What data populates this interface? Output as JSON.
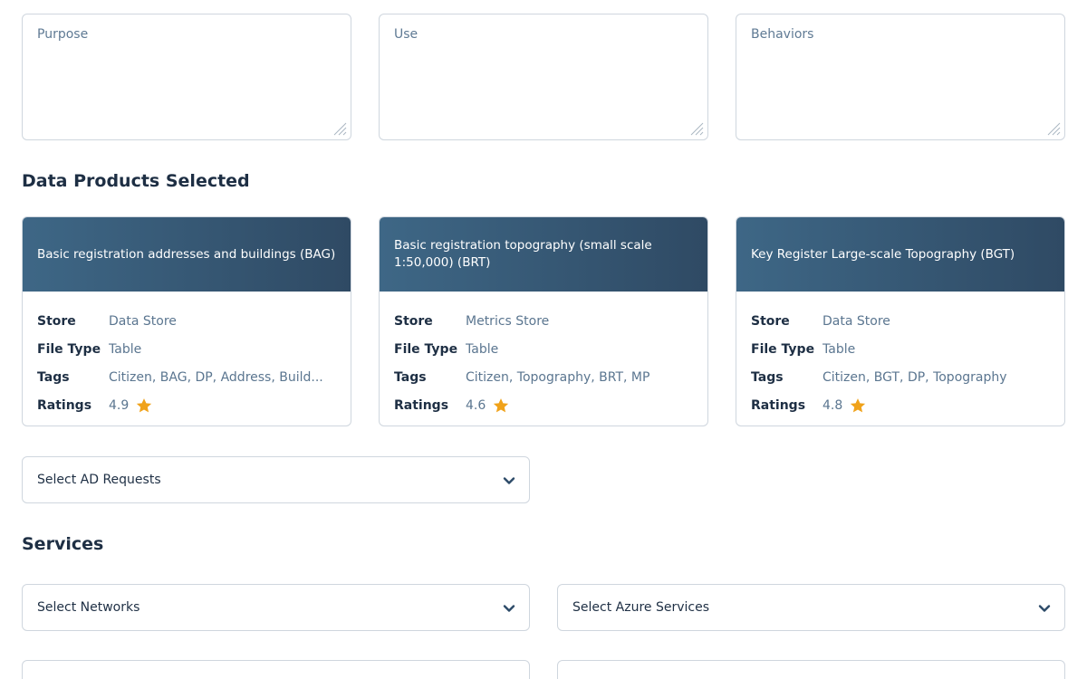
{
  "textareas": [
    {
      "placeholder": "Purpose"
    },
    {
      "placeholder": "Use"
    },
    {
      "placeholder": "Behaviors"
    }
  ],
  "data_products": {
    "title": "Data Products Selected",
    "labels": {
      "store": "Store",
      "file_type": "File Type",
      "tags": "Tags",
      "ratings": "Ratings"
    },
    "cards": [
      {
        "title": "Basic registration addresses and buildings (BAG)",
        "store": "Data Store",
        "file_type": "Table",
        "tags": "Citizen, BAG, DP, Address, Build...",
        "rating": "4.9"
      },
      {
        "title": "Basic registration topography (small scale 1:50,000) (BRT)",
        "store": "Metrics Store",
        "file_type": "Table",
        "tags": "Citizen, Topography, BRT, MP",
        "rating": "4.6"
      },
      {
        "title": "Key Register Large-scale Topography (BGT)",
        "store": "Data Store",
        "file_type": "Table",
        "tags": "Citizen, BGT, DP, Topography",
        "rating": "4.8"
      }
    ],
    "star_color": "#f0a21a"
  },
  "ad_requests": {
    "placeholder": "Select AD Requests"
  },
  "services": {
    "title": "Services",
    "networks": {
      "placeholder": "Select Networks"
    },
    "azure": {
      "placeholder": "Select Azure Services"
    }
  },
  "colors": {
    "card_header_start": "#3e6786",
    "card_header_end": "#2f4a64",
    "chevron": "#2c4a68",
    "border": "#cfd6de"
  }
}
